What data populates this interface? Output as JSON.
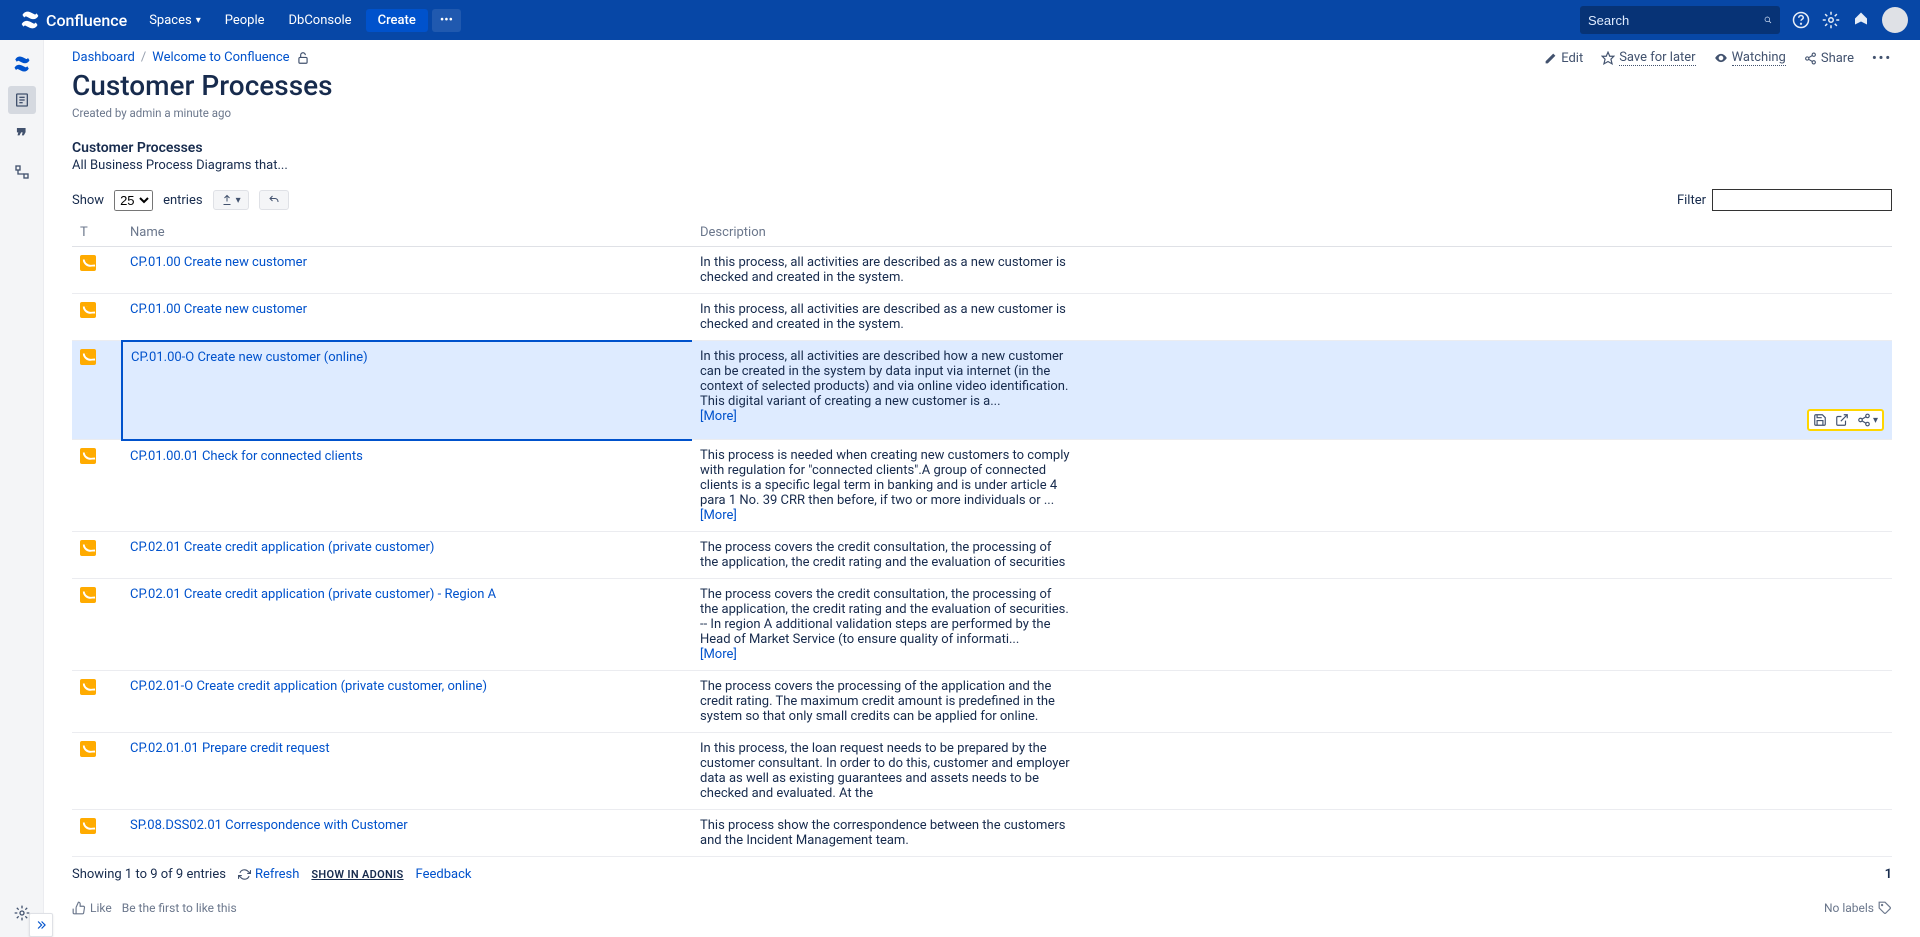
{
  "nav": {
    "logo": "Confluence",
    "spaces": "Spaces",
    "people": "People",
    "dbconsole": "DbConsole",
    "create": "Create",
    "search_placeholder": "Search"
  },
  "breadcrumb": {
    "dashboard": "Dashboard",
    "welcome": "Welcome to Confluence"
  },
  "actions": {
    "edit": "Edit",
    "save": "Save for later",
    "watching": "Watching",
    "share": "Share"
  },
  "page": {
    "title": "Customer Processes",
    "meta": "Created by admin a minute ago",
    "heading": "Customer Processes",
    "sub": "All Business Process Diagrams that..."
  },
  "toolbar": {
    "show": "Show",
    "count": "25",
    "entries": "entries",
    "filter": "Filter"
  },
  "cols": {
    "t": "T",
    "name": "Name",
    "desc": "Description"
  },
  "rows": [
    {
      "name": "CP.01.00 Create new customer",
      "desc": "In this process, all activities are described as a new customer is checked and created in the system.",
      "more": false,
      "selected": false
    },
    {
      "name": "CP.01.00 Create new customer",
      "desc": "In this process, all activities are described as a new customer is checked and created in the system.",
      "more": false,
      "selected": false
    },
    {
      "name": "CP.01.00-O Create new customer (online)",
      "desc": "In this process, all activities are described how a new customer can be created in the system by data input via internet (in the context of selected products) and via online video identification.   This digital variant of creating a new customer is a...",
      "more": true,
      "selected": true
    },
    {
      "name": "CP.01.00.01 Check for connected clients",
      "desc": "This process is needed when creating new customers to comply with regulation for \"connected clients\".A group of connected clients is a specific legal term in banking and is under article 4 para 1 No. 39 CRR then before, if two or more individuals or ...",
      "more": true,
      "selected": false
    },
    {
      "name": "CP.02.01 Create credit application (private customer)",
      "desc": "The process covers the credit consultation, the processing of the application, the credit rating and the evaluation of securities",
      "more": false,
      "selected": false
    },
    {
      "name": "CP.02.01 Create credit application (private customer) - Region A",
      "desc": "The process covers the credit consultation, the processing of the application, the credit rating and the evaluation of securities. -- In region A additional validation steps are performed by the Head of Market Service (to ensure quality of informati...",
      "more": true,
      "selected": false
    },
    {
      "name": "CP.02.01-O Create credit application (private customer, online)",
      "desc": "The process covers the processing of the application and the credit rating. The maximum credit amount is predefined in the system so that only small credits can be applied for online.",
      "more": false,
      "selected": false
    },
    {
      "name": "CP.02.01.01 Prepare credit request",
      "desc": "In this process, the loan request needs to be prepared by the customer consultant. In order to do this, customer and employer data as well as existing guarantees and assets needs to be checked and evaluated. At the",
      "more": false,
      "selected": false
    },
    {
      "name": "SP.08.DSS02.01 Correspondence with Customer",
      "desc": "This process show the correspondence between the customers and the Incident Management team.",
      "more": false,
      "selected": false
    }
  ],
  "more_label": "[More]",
  "footer": {
    "showing": "Showing 1 to 9 of 9 entries",
    "refresh": "Refresh",
    "show_adonis": "SHOW IN ADONIS",
    "feedback": "Feedback",
    "page": "1"
  },
  "like": {
    "like": "Like",
    "first": "Be the first to like this",
    "no_labels": "No labels"
  }
}
